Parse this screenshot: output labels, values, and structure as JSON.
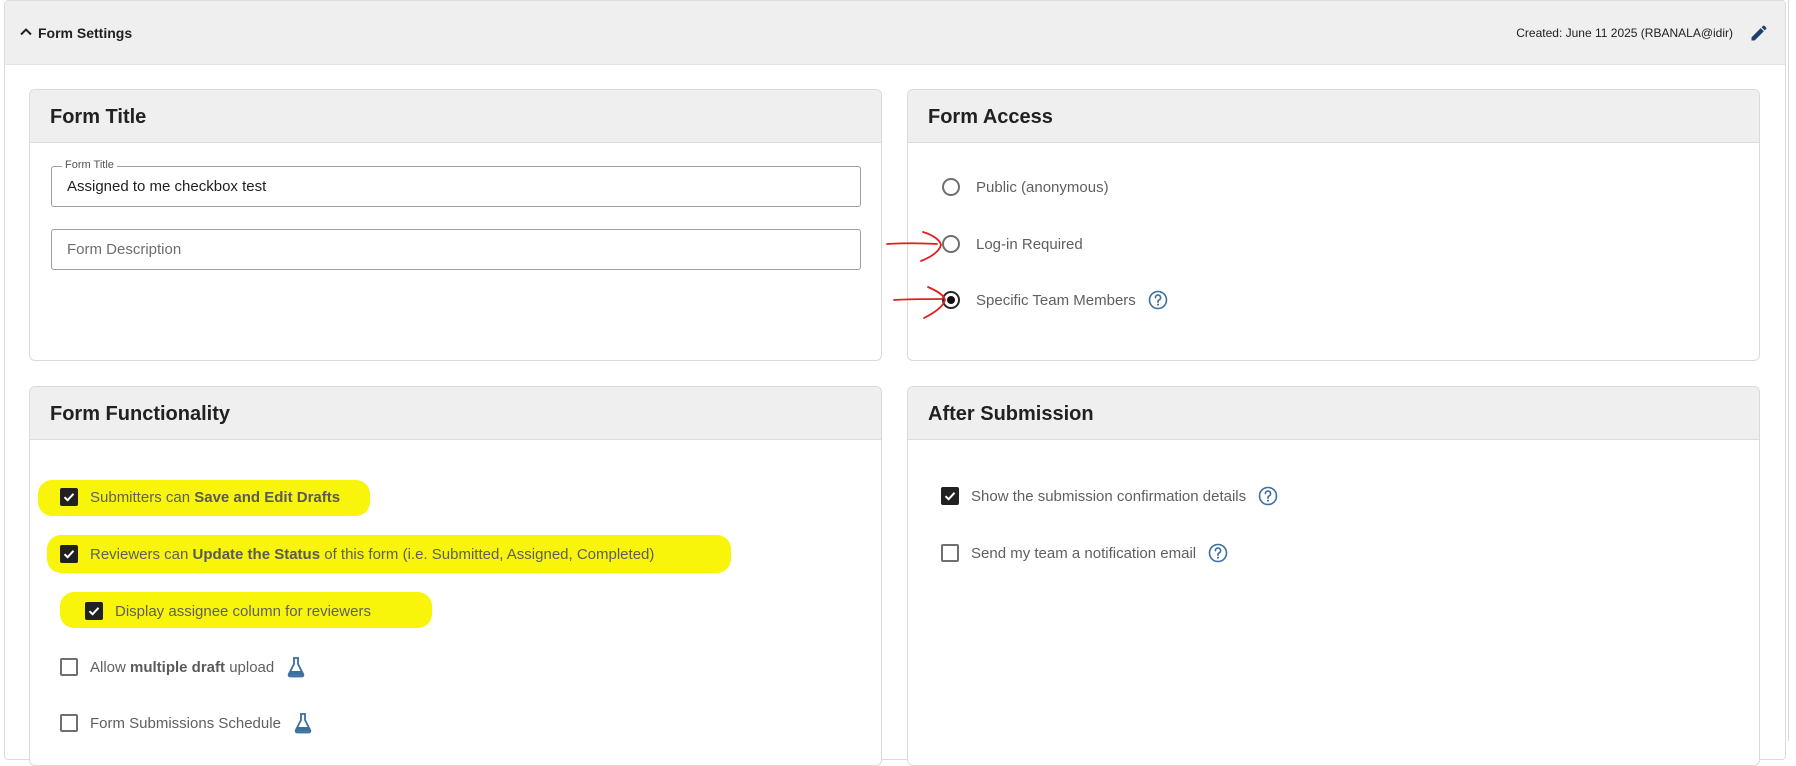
{
  "header": {
    "title": "Form Settings",
    "created": "Created: June 11 2025 (RBANALA@idir)"
  },
  "form_title_card": {
    "heading": "Form Title",
    "title_field": {
      "label": "Form Title",
      "value": "Assigned to me checkbox test"
    },
    "description_field": {
      "placeholder": "Form Description"
    }
  },
  "form_access_card": {
    "heading": "Form Access",
    "options": [
      {
        "label": "Public (anonymous)",
        "selected": false
      },
      {
        "label": "Log-in Required",
        "selected": false
      },
      {
        "label": "Specific Team Members",
        "selected": true
      }
    ]
  },
  "functionality_card": {
    "heading": "Form Functionality",
    "items": [
      {
        "pre": "Submitters can ",
        "bold": "Save and Edit Drafts",
        "post": "",
        "checked": true
      },
      {
        "pre": "Reviewers can ",
        "bold": "Update the Status",
        "post": " of this form (i.e. Submitted, Assigned, Completed)",
        "checked": true
      },
      {
        "pre": "Display assignee column for reviewers",
        "bold": "",
        "post": "",
        "checked": true
      },
      {
        "pre": "Allow ",
        "bold": "multiple draft",
        "post": " upload",
        "checked": false
      },
      {
        "pre": "Form Submissions Schedule",
        "bold": "",
        "post": "",
        "checked": false
      }
    ]
  },
  "after_card": {
    "heading": "After Submission",
    "items": [
      {
        "label": "Show the submission confirmation details",
        "checked": true
      },
      {
        "label": "Send my team a notification email",
        "checked": false
      }
    ]
  },
  "colors": {
    "highlight": "#f8f50a",
    "annotation_arrow": "#e02020",
    "icon_blue": "#1f5a8a"
  },
  "icons": {
    "collapse": "chevron-up-icon",
    "edit": "pencil-icon",
    "help": "help-circle-icon",
    "experimental": "flask-icon"
  }
}
